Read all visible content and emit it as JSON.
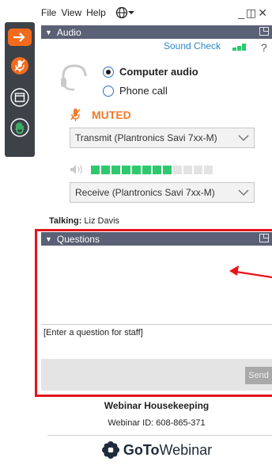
{
  "menu": {
    "file": "File",
    "view": "View",
    "help": "Help"
  },
  "audio": {
    "header": "Audio",
    "sound_check": "Sound Check",
    "sound_check_help": "?",
    "options": [
      {
        "label": "Computer audio",
        "selected": true
      },
      {
        "label": "Phone call",
        "selected": false
      }
    ],
    "muted_label": "MUTED",
    "transmit_device": "Transmit (Plantronics Savi 7xx-M)",
    "receive_device": "Receive (Plantronics Savi 7xx-M)",
    "speaker_level": {
      "active_segments": 8,
      "total_segments": 12
    }
  },
  "talking": {
    "label": "Talking:",
    "name": "Liz Davis"
  },
  "questions": {
    "header": "Questions",
    "input_placeholder": "[Enter a question for staff]",
    "send_label": "Send"
  },
  "footer": {
    "title": "Webinar Housekeeping",
    "webinar_id": "Webinar ID: 608-865-371",
    "logo_goto": "GoTo",
    "logo_webinar": "Webinar"
  },
  "colors": {
    "accent_orange": "#f26b1d",
    "header_bg": "#5a6075",
    "level_green": "#2ec96d",
    "muted_orange": "#f07a2a",
    "highlight_red": "#e5141b"
  }
}
